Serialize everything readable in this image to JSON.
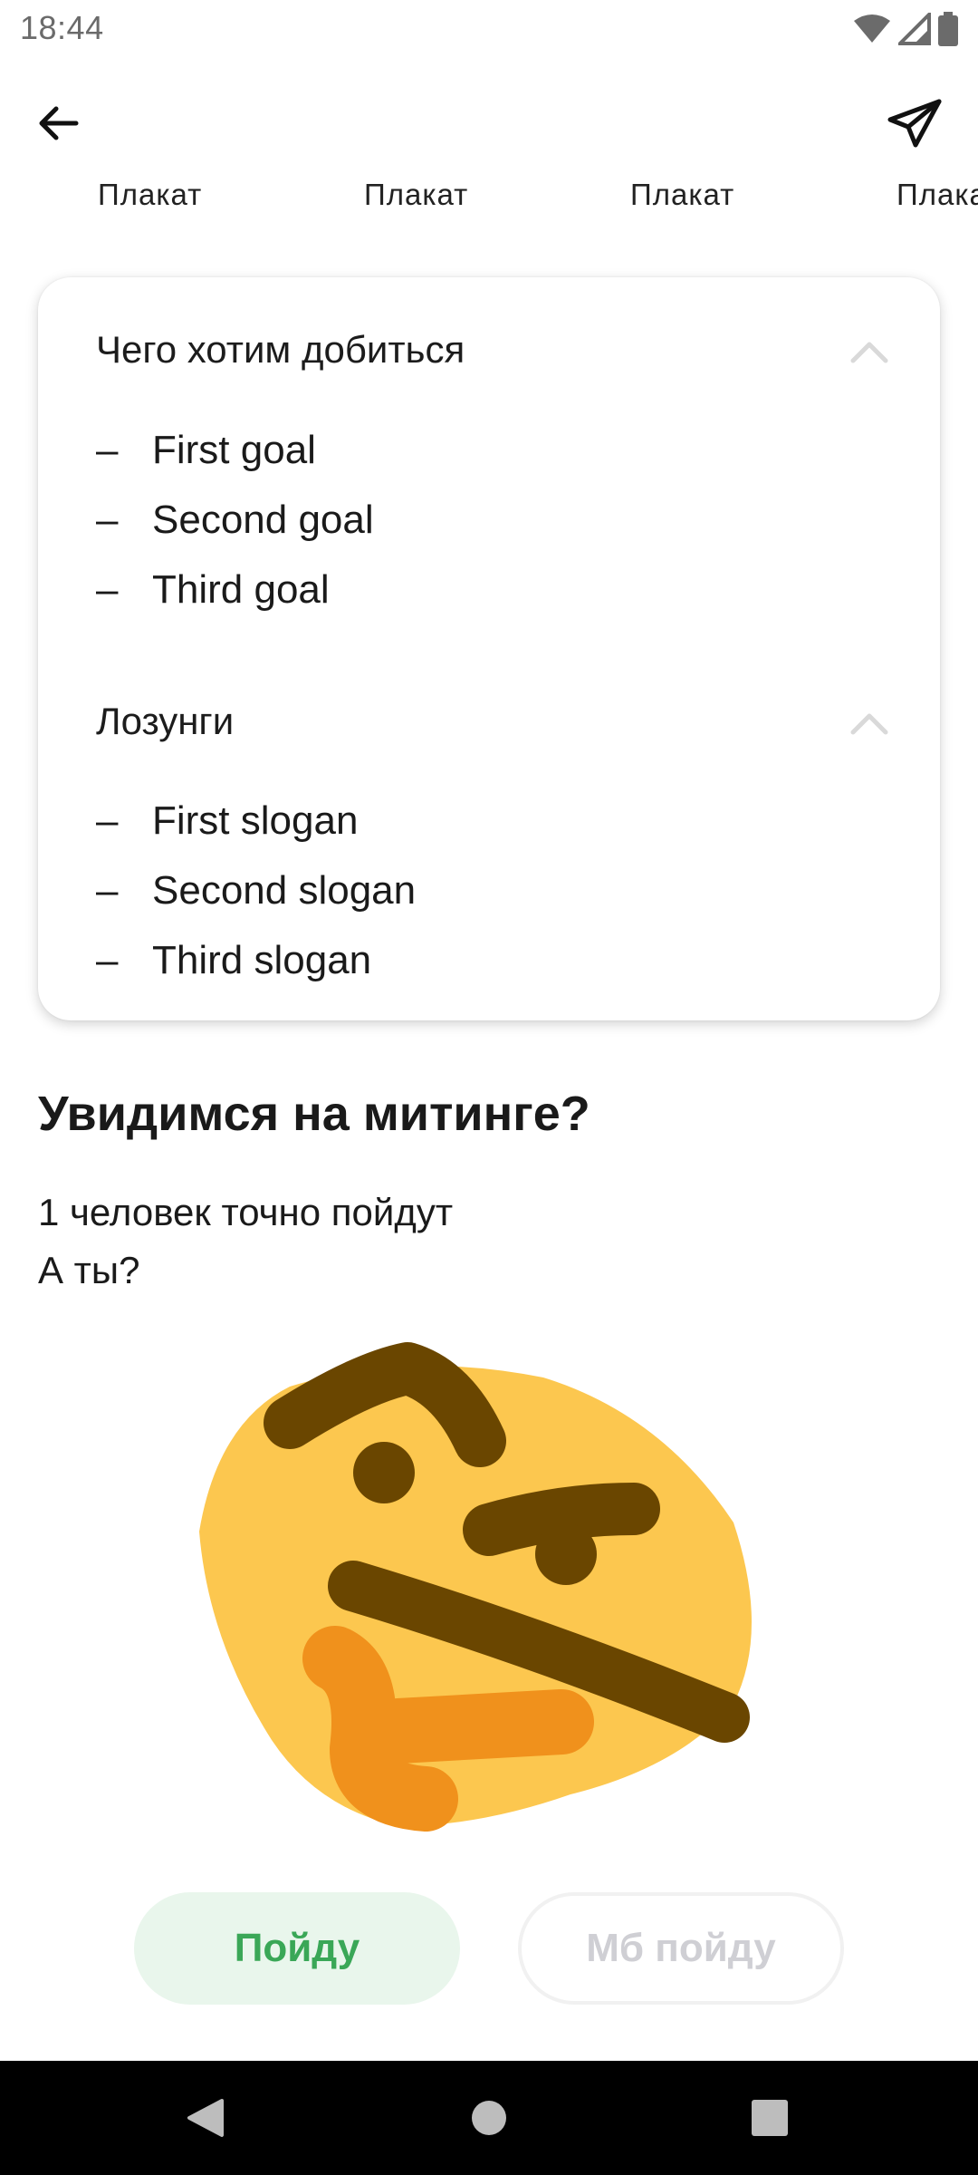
{
  "status_bar": {
    "time": "18:44",
    "icons": [
      "wifi-icon",
      "signal-icon",
      "battery-icon"
    ]
  },
  "app_bar": {
    "back_icon": "arrow-left-icon",
    "share_icon": "paper-plane-icon"
  },
  "poster_tabs": [
    "Плакат",
    "Плакат",
    "Плакат",
    "Плакат"
  ],
  "card": {
    "goals": {
      "title": "Чего хотим добиться",
      "items": [
        "First goal",
        "Second goal",
        "Third goal"
      ],
      "expanded": true
    },
    "slogans": {
      "title": "Лозунги",
      "items": [
        "First slogan",
        "Second slogan",
        "Third slogan"
      ],
      "expanded": true
    },
    "bullet": "–"
  },
  "rally": {
    "title": "Увидимся на митинге?",
    "line1": "1 человек точно пойдут",
    "line2": "А ты?"
  },
  "actions": {
    "go_label": "Пойду",
    "maybe_label": "Мб пойду"
  },
  "nav": {
    "back": "nav-back-icon",
    "home": "nav-home-icon",
    "recents": "nav-recents-icon"
  },
  "colors": {
    "accent_green": "#3aa757",
    "accent_green_bg": "#e9f6ec",
    "emoji_face": "#fcc74f",
    "emoji_features": "#6a4600",
    "emoji_hand": "#f0911c"
  }
}
